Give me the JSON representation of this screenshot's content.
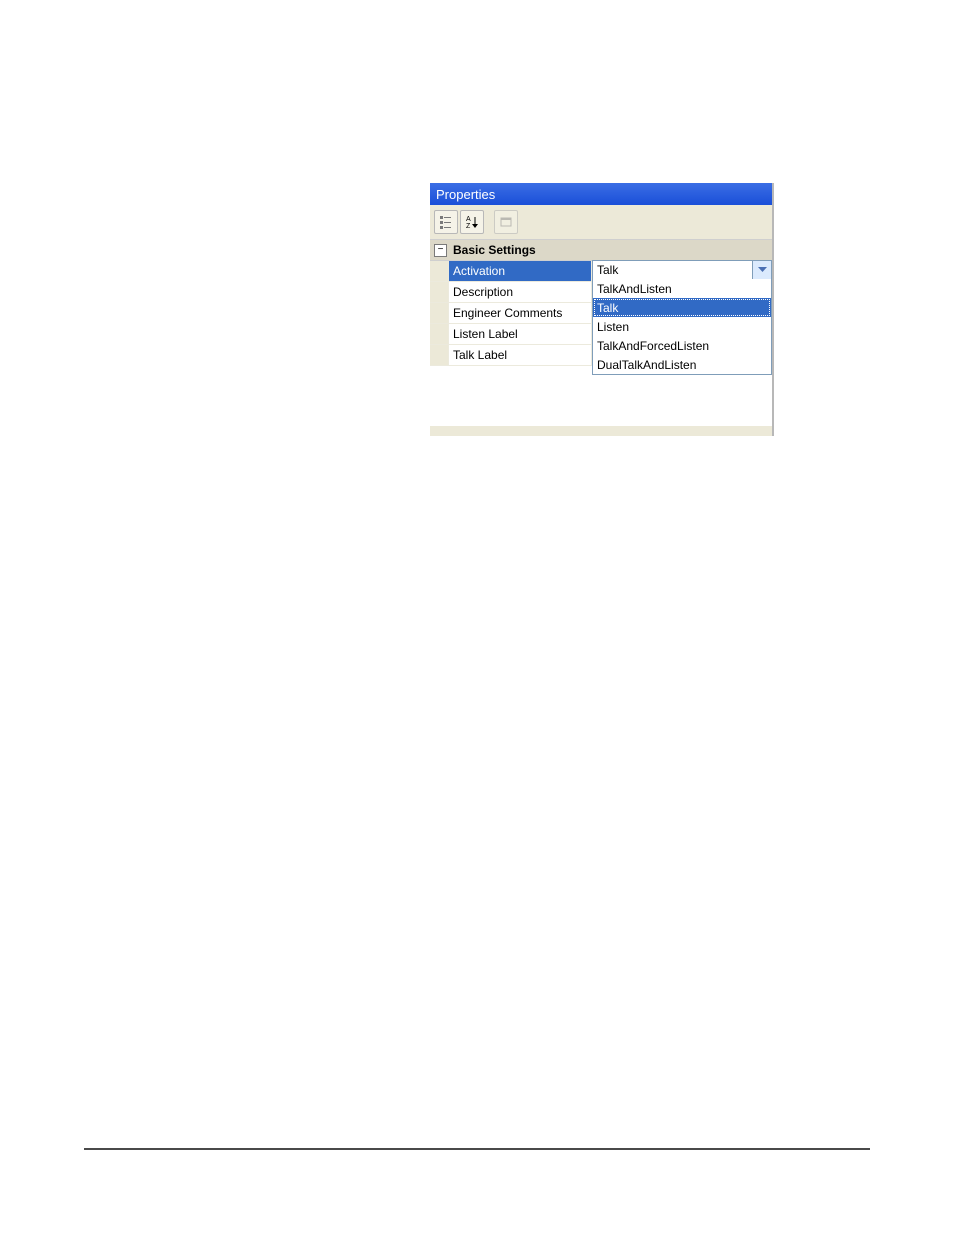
{
  "panel": {
    "title": "Properties",
    "category": "Basic Settings",
    "categoryToggle": "−",
    "rows": [
      {
        "name": "Activation",
        "value": "Talk",
        "selected": true,
        "combo": true
      },
      {
        "name": "Description",
        "value": "",
        "selected": false
      },
      {
        "name": "Engineer Comments",
        "value": "",
        "selected": false
      },
      {
        "name": "Listen Label",
        "value": "",
        "selected": false
      },
      {
        "name": "Talk Label",
        "value": "",
        "selected": false
      }
    ],
    "dropdown": {
      "options": [
        {
          "label": "TalkAndListen",
          "highlighted": false
        },
        {
          "label": "Talk",
          "highlighted": true
        },
        {
          "label": "Listen",
          "highlighted": false
        },
        {
          "label": "TalkAndForcedListen",
          "highlighted": false
        },
        {
          "label": "DualTalkAndListen",
          "highlighted": false
        }
      ]
    }
  }
}
